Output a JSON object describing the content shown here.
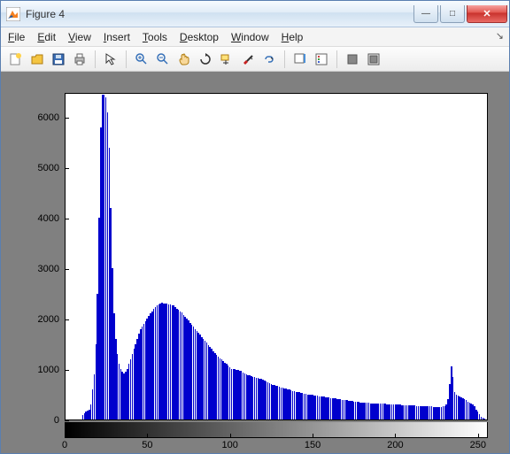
{
  "window": {
    "title": "Figure 4"
  },
  "menu": {
    "file": "File",
    "edit": "Edit",
    "view": "View",
    "insert": "Insert",
    "tools": "Tools",
    "desktop": "Desktop",
    "window": "Window",
    "help": "Help"
  },
  "chart_data": {
    "type": "bar",
    "title": "",
    "xlabel": "",
    "ylabel": "",
    "xlim": [
      0,
      256
    ],
    "ylim": [
      0,
      6500
    ],
    "xticks": [
      0,
      50,
      100,
      150,
      200,
      250
    ],
    "yticks": [
      0,
      1000,
      2000,
      3000,
      4000,
      5000,
      6000
    ],
    "categories_range": [
      0,
      255
    ],
    "values": [
      0,
      0,
      0,
      0,
      0,
      0,
      0,
      0,
      0,
      0,
      80,
      120,
      150,
      180,
      200,
      300,
      600,
      900,
      1500,
      2500,
      4000,
      5800,
      6450,
      6450,
      6400,
      6100,
      5400,
      4200,
      3000,
      2100,
      1600,
      1300,
      1100,
      1000,
      950,
      920,
      950,
      1000,
      1100,
      1200,
      1300,
      1400,
      1500,
      1600,
      1700,
      1800,
      1850,
      1900,
      1950,
      2000,
      2050,
      2100,
      2150,
      2200,
      2230,
      2260,
      2290,
      2310,
      2320,
      2310,
      2300,
      2300,
      2290,
      2280,
      2270,
      2260,
      2240,
      2200,
      2180,
      2150,
      2120,
      2080,
      2040,
      2000,
      1960,
      1920,
      1880,
      1840,
      1800,
      1760,
      1720,
      1680,
      1640,
      1600,
      1560,
      1520,
      1480,
      1440,
      1400,
      1360,
      1320,
      1280,
      1250,
      1220,
      1190,
      1160,
      1130,
      1100,
      1070,
      1040,
      1010,
      1000,
      1000,
      990,
      980,
      970,
      960,
      940,
      920,
      900,
      880,
      870,
      860,
      850,
      840,
      830,
      820,
      810,
      800,
      790,
      780,
      760,
      740,
      720,
      700,
      690,
      680,
      670,
      660,
      650,
      640,
      630,
      620,
      610,
      600,
      590,
      580,
      570,
      560,
      550,
      545,
      540,
      530,
      520,
      510,
      505,
      500,
      495,
      490,
      485,
      480,
      475,
      470,
      465,
      460,
      455,
      450,
      445,
      440,
      435,
      430,
      425,
      420,
      415,
      410,
      405,
      400,
      395,
      390,
      385,
      380,
      375,
      370,
      365,
      360,
      355,
      350,
      345,
      340,
      335,
      332,
      330,
      328,
      326,
      324,
      322,
      320,
      318,
      316,
      314,
      312,
      310,
      310,
      308,
      306,
      304,
      302,
      300,
      300,
      298,
      296,
      294,
      292,
      290,
      288,
      286,
      284,
      282,
      280,
      278,
      276,
      274,
      272,
      270,
      268,
      266,
      264,
      262,
      260,
      260,
      258,
      256,
      254,
      252,
      250,
      250,
      250,
      255,
      260,
      270,
      300,
      400,
      700,
      1050,
      850,
      550,
      500,
      480,
      460,
      440,
      420,
      400,
      380,
      360,
      340,
      320,
      300,
      260,
      200,
      150,
      100,
      60,
      30,
      10,
      0,
      0
    ]
  }
}
